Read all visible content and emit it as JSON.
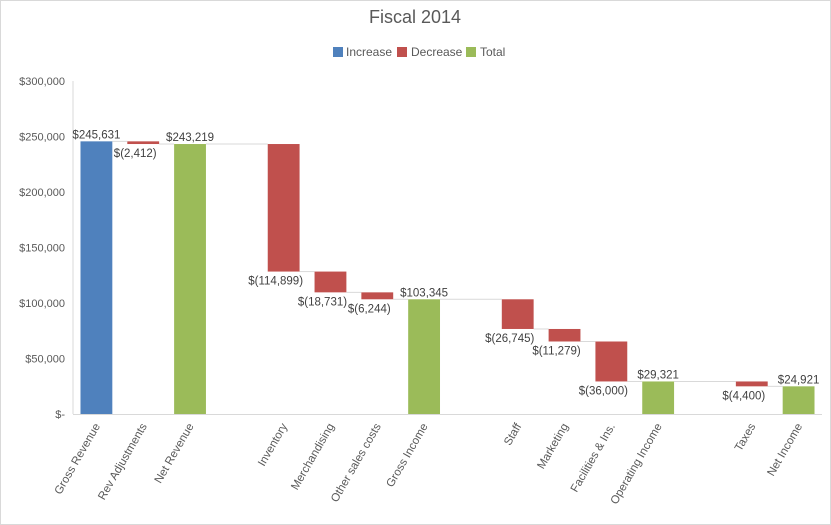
{
  "chart_data": {
    "type": "bar",
    "subtype": "waterfall",
    "title": "Fiscal 2014",
    "xlabel": "",
    "ylabel": "",
    "ylim": [
      0,
      300000
    ],
    "yticks": [
      0,
      50000,
      100000,
      150000,
      200000,
      250000,
      300000
    ],
    "ytick_labels": [
      "$-",
      "$50,000",
      "$100,000",
      "$150,000",
      "$200,000",
      "$250,000",
      "$300,000"
    ],
    "grid": false,
    "legend": {
      "placement": "top-center",
      "entries": [
        {
          "name": "Increase",
          "color": "#4f81bd"
        },
        {
          "name": "Decrease",
          "color": "#c0504d"
        },
        {
          "name": "Total",
          "color": "#9bbb59"
        }
      ]
    },
    "categories": [
      "Gross Revenue",
      "Rev Adjustments",
      "Net Revenue",
      "",
      "Inventory",
      "Merchandising",
      "Other sales costs",
      "Gross Income",
      "",
      "Staff",
      "Marketing",
      "Facilities & Ins.",
      "Operating Income",
      "",
      "Taxes",
      "Net Income"
    ],
    "points": [
      {
        "category": "Gross Revenue",
        "kind": "Increase",
        "value": 245631,
        "label": "$245,631"
      },
      {
        "category": "Rev Adjustments",
        "kind": "Decrease",
        "value": -2412,
        "label": "$(2,412)"
      },
      {
        "category": "Net Revenue",
        "kind": "Total",
        "value": 243219,
        "label": "$243,219"
      },
      {
        "category": "",
        "kind": "Gap",
        "value": null,
        "label": ""
      },
      {
        "category": "Inventory",
        "kind": "Decrease",
        "value": -114899,
        "label": "$(114,899)"
      },
      {
        "category": "Merchandising",
        "kind": "Decrease",
        "value": -18731,
        "label": "$(18,731)"
      },
      {
        "category": "Other sales costs",
        "kind": "Decrease",
        "value": -6244,
        "label": "$(6,244)"
      },
      {
        "category": "Gross Income",
        "kind": "Total",
        "value": 103345,
        "label": "$103,345"
      },
      {
        "category": "",
        "kind": "Gap",
        "value": null,
        "label": ""
      },
      {
        "category": "Staff",
        "kind": "Decrease",
        "value": -26745,
        "label": "$(26,745)"
      },
      {
        "category": "Marketing",
        "kind": "Decrease",
        "value": -11279,
        "label": "$(11,279)"
      },
      {
        "category": "Facilities & Ins.",
        "kind": "Decrease",
        "value": -36000,
        "label": "$(36,000)"
      },
      {
        "category": "Operating Income",
        "kind": "Total",
        "value": 29321,
        "label": "$29,321"
      },
      {
        "category": "",
        "kind": "Gap",
        "value": null,
        "label": ""
      },
      {
        "category": "Taxes",
        "kind": "Decrease",
        "value": -4400,
        "label": "$(4,400)"
      },
      {
        "category": "Net Income",
        "kind": "Total",
        "value": 24921,
        "label": "$24,921"
      }
    ],
    "colors": {
      "Increase": "#4f81bd",
      "Decrease": "#c0504d",
      "Total": "#9bbb59",
      "connector": "#d9d9d9",
      "axis": "#d9d9d9"
    }
  }
}
